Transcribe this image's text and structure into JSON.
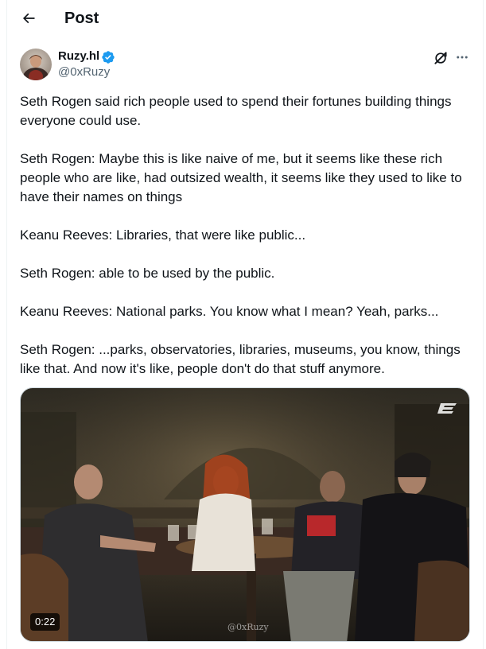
{
  "header": {
    "title": "Post"
  },
  "author": {
    "display_name": "Ruzy.hl",
    "handle": "@0xRuzy",
    "verified": true,
    "verified_color": "#1d9bf0"
  },
  "post": {
    "paragraphs": [
      "Seth Rogen said rich people used to spend their fortunes building things everyone could use.",
      "Seth Rogen: Maybe this is like naive of me, but it seems like these rich people who are like, had outsized wealth, it seems like they used to like to have their names on things",
      "Keanu Reeves: Libraries, that were like public...",
      "Seth Rogen: able to be used by the public.",
      "Keanu Reeves: National parks. You know what I mean? Yeah, parks...",
      "Seth Rogen: ...parks, observatories, libraries, museums, you know, things like that. And now it's like, people don't do that stuff anymore."
    ]
  },
  "media": {
    "type": "video",
    "duration": "0:22",
    "watermark": "@0xRuzy"
  },
  "icons": {
    "back": "arrow-left-icon",
    "verified": "verified-badge-icon",
    "grok": "grok-icon",
    "more": "more-horizontal-icon"
  }
}
